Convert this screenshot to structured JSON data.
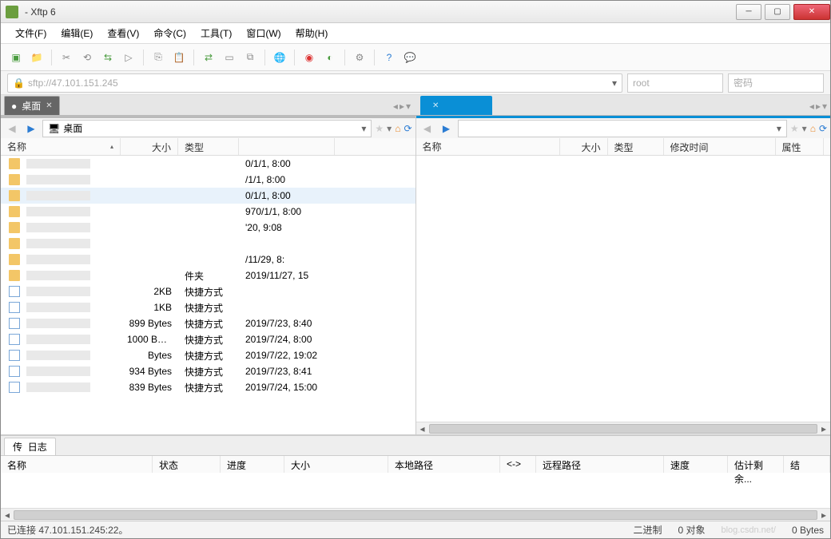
{
  "title": "- Xftp 6",
  "menu": [
    "文件(F)",
    "编辑(E)",
    "查看(V)",
    "命令(C)",
    "工具(T)",
    "窗口(W)",
    "帮助(H)"
  ],
  "address": {
    "url": "sftp://47.101.151.245",
    "user_ph": "root",
    "pass_ph": "密码"
  },
  "tabs": {
    "left": {
      "label": "桌面"
    },
    "right": {
      "label": ""
    }
  },
  "leftpane": {
    "path": "桌面",
    "cols": {
      "name": "名称",
      "size": "大小",
      "type": "类型"
    },
    "rows": [
      {
        "size": "",
        "type": "",
        "date": "0/1/1, 8:00"
      },
      {
        "size": "",
        "type": "",
        "date": "/1/1, 8:00"
      },
      {
        "size": "",
        "type": "",
        "date": "0/1/1, 8:00",
        "sel": true
      },
      {
        "size": "",
        "type": "",
        "date": "970/1/1, 8:00"
      },
      {
        "size": "",
        "type": "",
        "date": "'20, 9:08"
      },
      {
        "size": "",
        "type": "",
        "date": ""
      },
      {
        "size": "",
        "type": "",
        "date": "/11/29, 8:"
      },
      {
        "size": "",
        "type": "件夹",
        "date": "2019/11/27, 15"
      },
      {
        "size": "2KB",
        "type": "快捷方式",
        "date": ""
      },
      {
        "size": "1KB",
        "type": "快捷方式",
        "date": ""
      },
      {
        "size": "899 Bytes",
        "type": "快捷方式",
        "date": "2019/7/23, 8:40"
      },
      {
        "size": "1000 Byt...",
        "type": "快捷方式",
        "date": "2019/7/24, 8:00"
      },
      {
        "size": "Bytes",
        "type": "快捷方式",
        "date": "2019/7/22, 19:02"
      },
      {
        "size": "934 Bytes",
        "type": "快捷方式",
        "date": "2019/7/23, 8:41"
      },
      {
        "size": "839 Bytes",
        "type": "快捷方式",
        "date": "2019/7/24, 15:00"
      }
    ]
  },
  "rightpane": {
    "cols": {
      "name": "名称",
      "size": "大小",
      "type": "类型",
      "date": "修改时间",
      "attr": "属性"
    }
  },
  "xfer": {
    "tab1": "传",
    "tab2": "日志",
    "cols": {
      "name": "名称",
      "status": "状态",
      "progress": "进度",
      "size": "大小",
      "lpath": "本地路径",
      "dir": "<->",
      "rpath": "远程路径",
      "speed": "速度",
      "eta": "估计剩余...",
      "end": "结"
    }
  },
  "status": {
    "conn": "已连接 47.101.151.245:22。",
    "mode": "二进制",
    "count": "0 对象",
    "bytes": "0 Bytes",
    "wm": "blog.csdn.net/"
  }
}
